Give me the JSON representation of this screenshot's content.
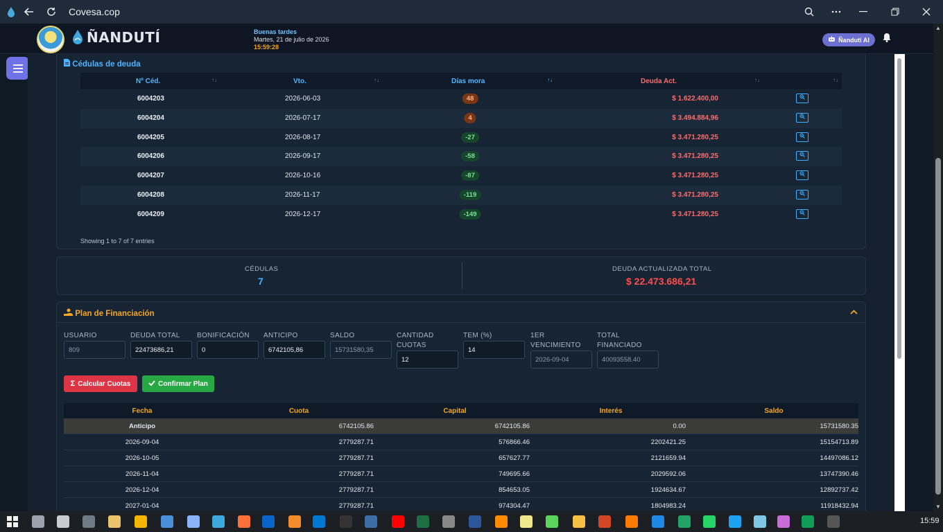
{
  "browser": {
    "title": "Covesa.cop",
    "icons": [
      "app-icon",
      "back-arrow-icon",
      "reload-icon",
      "zoom-icon",
      "more-icon",
      "minimize-icon",
      "maximize-icon",
      "close-icon"
    ]
  },
  "header": {
    "brand": "ÑANDUTÍ",
    "greeting": "Buenas tardes",
    "date": "Martes, 21 de julio de 2026",
    "time": "15:59:28",
    "ai_button": "Ñanduti AI"
  },
  "cedulas": {
    "title": "Cédulas de deuda",
    "columns": [
      "Nº Céd.",
      "Vto.",
      "Días mora",
      "Deuda Act."
    ],
    "rows": [
      {
        "num": "6004203",
        "vto": "2026-06-03",
        "mora": "48",
        "deuda": "$ 1.622.400,00",
        "late": true
      },
      {
        "num": "6004204",
        "vto": "2026-07-17",
        "mora": "4",
        "deuda": "$ 3.494.884,96",
        "late": true
      },
      {
        "num": "6004205",
        "vto": "2026-08-17",
        "mora": "-27",
        "deuda": "$ 3.471.280,25",
        "late": false
      },
      {
        "num": "6004206",
        "vto": "2026-09-17",
        "mora": "-58",
        "deuda": "$ 3.471.280,25",
        "late": false
      },
      {
        "num": "6004207",
        "vto": "2026-10-16",
        "mora": "-87",
        "deuda": "$ 3.471.280,25",
        "late": false
      },
      {
        "num": "6004208",
        "vto": "2026-11-17",
        "mora": "-119",
        "deuda": "$ 3.471.280,25",
        "late": false
      },
      {
        "num": "6004209",
        "vto": "2026-12-17",
        "mora": "-149",
        "deuda": "$ 3.471.280,25",
        "late": false
      }
    ],
    "footer": "Showing 1 to 7 of 7 entries"
  },
  "summary": {
    "cedulas_label": "CÉDULAS",
    "cedulas_value": "7",
    "deuda_label": "DEUDA ACTUALIZADA TOTAL",
    "deuda_value": "$ 22.473.686,21"
  },
  "plan": {
    "title": "Plan de Financiación",
    "fields": [
      {
        "label": "USUARIO",
        "value": "809",
        "readonly": true
      },
      {
        "label": "DEUDA TOTAL",
        "value": "22473686,21",
        "readonly": false
      },
      {
        "label": "BONIFICACIÓN",
        "value": "0",
        "readonly": false
      },
      {
        "label": "ANTICIPO",
        "value": "6742105,86",
        "readonly": false
      },
      {
        "label": "SALDO",
        "value": "15731580,35",
        "readonly": true
      },
      {
        "label": "CANTIDAD CUOTAS",
        "value": "12",
        "readonly": false
      },
      {
        "label": "TEM (%)",
        "value": "14",
        "readonly": false
      },
      {
        "label": "1ER VENCIMIENTO",
        "value": "2026-09-04",
        "readonly": true
      },
      {
        "label": "TOTAL FINANCIADO",
        "value": "40093558.40",
        "readonly": true
      }
    ],
    "btn_calcular": "Calcular Cuotas",
    "btn_confirmar": "Confirmar Plan",
    "columns": [
      "Fecha",
      "Cuota",
      "Capital",
      "Interés",
      "Saldo"
    ],
    "rows": [
      {
        "fecha": "Anticipo",
        "cuota": "6742105.86",
        "capital": "6742105.86",
        "interes": "0.00",
        "saldo": "15731580.35"
      },
      {
        "fecha": "2026-09-04",
        "cuota": "2779287.71",
        "capital": "576866.46",
        "interes": "2202421.25",
        "saldo": "15154713.89"
      },
      {
        "fecha": "2026-10-05",
        "cuota": "2779287.71",
        "capital": "657627.77",
        "interes": "2121659.94",
        "saldo": "14497086.12"
      },
      {
        "fecha": "2026-11-04",
        "cuota": "2779287.71",
        "capital": "749695.66",
        "interes": "2029592.06",
        "saldo": "13747390.46"
      },
      {
        "fecha": "2026-12-04",
        "cuota": "2779287.71",
        "capital": "854653.05",
        "interes": "1924634.67",
        "saldo": "12892737.42"
      },
      {
        "fecha": "2027-01-04",
        "cuota": "2779287.71",
        "capital": "974304.47",
        "interes": "1804983.24",
        "saldo": "11918432.94"
      }
    ]
  },
  "taskbar": {
    "clock": "15:59"
  }
}
